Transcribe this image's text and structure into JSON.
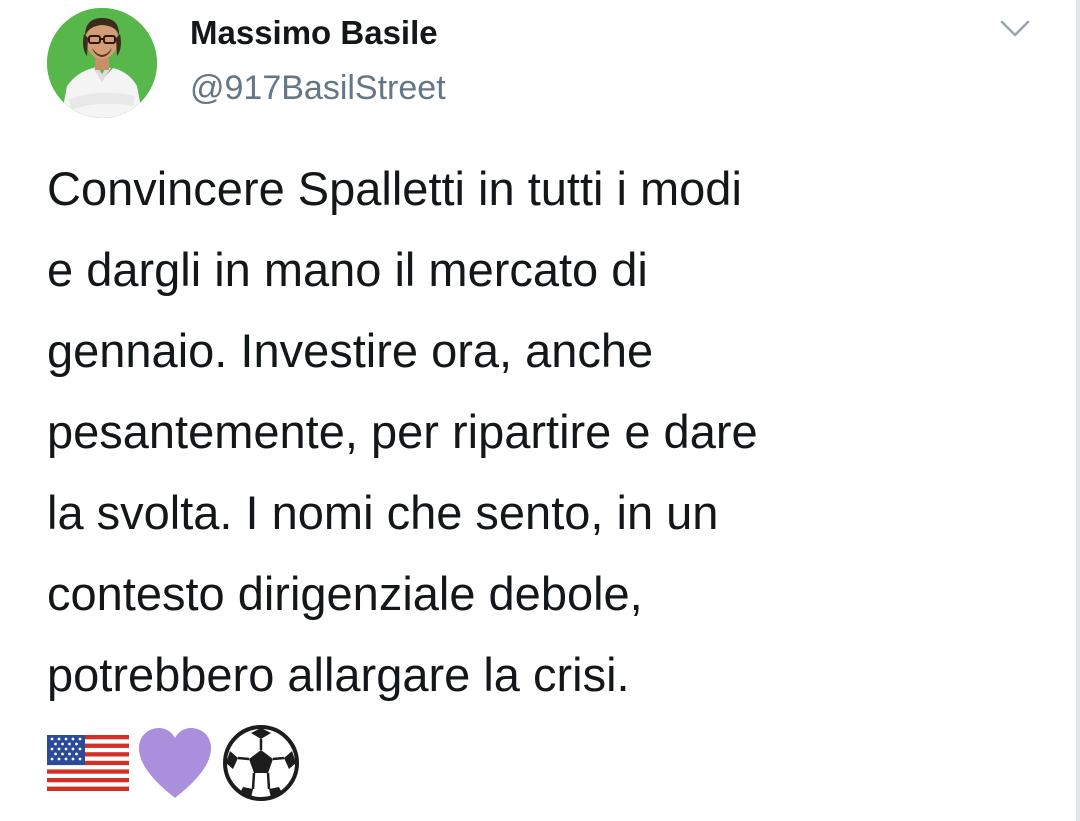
{
  "tweet": {
    "author": {
      "display_name": "Massimo Basile",
      "handle": "@917BasilStreet"
    },
    "text": "Convincere Spalletti in tutti i modi\ne dargli in mano il mercato di\ngennaio. Investire ora, anche\npesantemente, per ripartire e dare\nla svolta. I nomi che sento, in un\ncontesto dirigenziale debole,\npotrebbero allargare la crisi.",
    "emojis": [
      "us-flag-emoji",
      "purple-heart-emoji",
      "soccer-ball-emoji"
    ]
  },
  "colors": {
    "text": "#14171a",
    "handle": "#657786",
    "avatar_background": "#58b74a",
    "heart": "#a98fdc",
    "chevron": "#9aa6b2"
  }
}
